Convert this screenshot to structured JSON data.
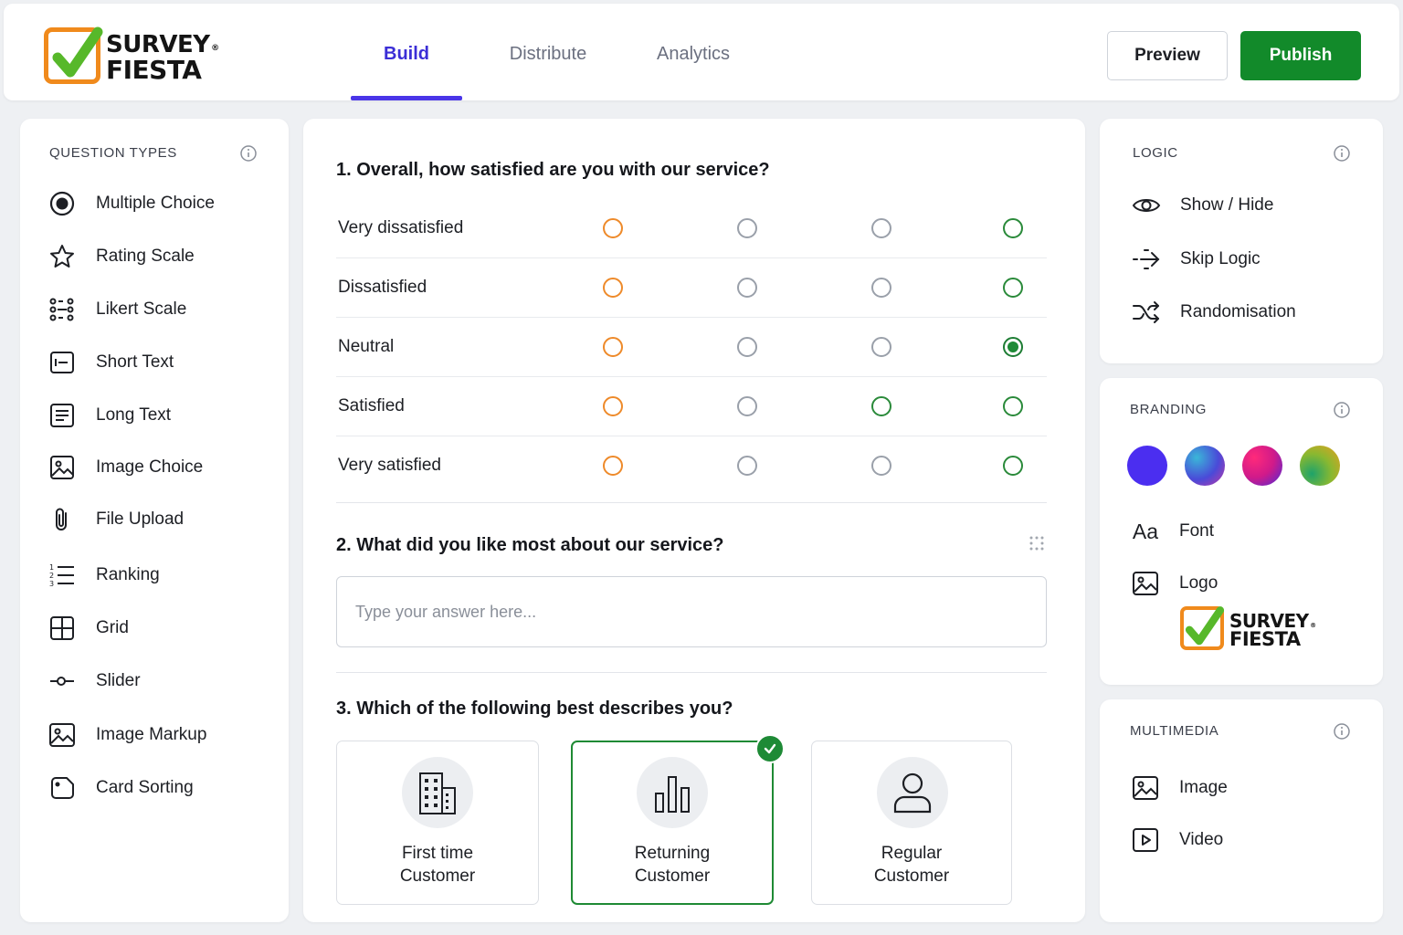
{
  "brand": {
    "line1": "SURVEY",
    "line2": "FIESTA",
    "registered": "®",
    "check_color": "#57b82a",
    "border_color": "#f08a1c"
  },
  "tabs": [
    {
      "label": "Build",
      "active": true
    },
    {
      "label": "Distribute",
      "active": false
    },
    {
      "label": "Analytics",
      "active": false
    }
  ],
  "actions": {
    "preview_label": "Preview",
    "publish_label": "Publish",
    "publish_color": "#128a2a"
  },
  "question_types": {
    "title": "QUESTION TYPES",
    "items": [
      {
        "label": "Multiple Choice",
        "icon": "radio-icon"
      },
      {
        "label": "Rating Scale",
        "icon": "star-icon"
      },
      {
        "label": "Likert Scale",
        "icon": "likert-icon"
      },
      {
        "label": "Short Text",
        "icon": "short-text-icon"
      },
      {
        "label": "Long Text",
        "icon": "long-text-icon"
      },
      {
        "label": "Image Choice",
        "icon": "image-icon"
      },
      {
        "label": "File Upload",
        "icon": "paperclip-icon"
      },
      {
        "label": "Ranking",
        "icon": "ranking-icon"
      },
      {
        "label": "Grid",
        "icon": "grid-icon"
      },
      {
        "label": "Slider",
        "icon": "slider-icon"
      },
      {
        "label": "Image Markup",
        "icon": "image-markup-icon"
      },
      {
        "label": "Card Sorting",
        "icon": "card-sorting-icon"
      }
    ]
  },
  "questions": {
    "q1": {
      "title": "1.  Overall, how satisfied are you with our service?",
      "rows": [
        {
          "label": "Very dissatisfied",
          "radios": [
            "orange",
            "gray",
            "gray",
            "green"
          ]
        },
        {
          "label": "Dissatisfied",
          "radios": [
            "orange",
            "gray",
            "gray",
            "green"
          ]
        },
        {
          "label": "Neutral",
          "radios": [
            "orange",
            "gray",
            "gray",
            "selected"
          ]
        },
        {
          "label": "Satisfied",
          "radios": [
            "orange",
            "gray",
            "green",
            "green"
          ]
        },
        {
          "label": "Very satisfied",
          "radios": [
            "orange",
            "gray",
            "gray",
            "green"
          ]
        }
      ]
    },
    "q2": {
      "title": "2.  What did you like most about our service?",
      "placeholder": "Type your answer here..."
    },
    "q3": {
      "title": "3.  Which of the following best describes you?",
      "options": [
        {
          "line1": "First time",
          "line2": "Customer",
          "icon": "building-icon",
          "selected": false
        },
        {
          "line1": "Returning",
          "line2": "Customer",
          "icon": "bar-chart-icon",
          "selected": true
        },
        {
          "line1": "Regular",
          "line2": "Customer",
          "icon": "user-icon",
          "selected": false
        }
      ]
    }
  },
  "logic": {
    "title": "LOGIC",
    "items": [
      {
        "label": "Show / Hide",
        "icon": "eye-icon"
      },
      {
        "label": "Skip Logic",
        "icon": "skip-arrow-icon"
      },
      {
        "label": "Randomisation",
        "icon": "shuffle-icon"
      }
    ]
  },
  "branding": {
    "title": "BRANDING",
    "swatches": [
      "#4b2ef0",
      "teal-purple-gradient",
      "pink-purple-gradient",
      "green-orange-gradient"
    ],
    "font_glyph": "Aa",
    "font_label": "Font",
    "logo_label": "Logo"
  },
  "multimedia": {
    "title": "MULTIMEDIA",
    "items": [
      {
        "label": "Image",
        "icon": "image-icon"
      },
      {
        "label": "Video",
        "icon": "video-icon"
      }
    ]
  }
}
